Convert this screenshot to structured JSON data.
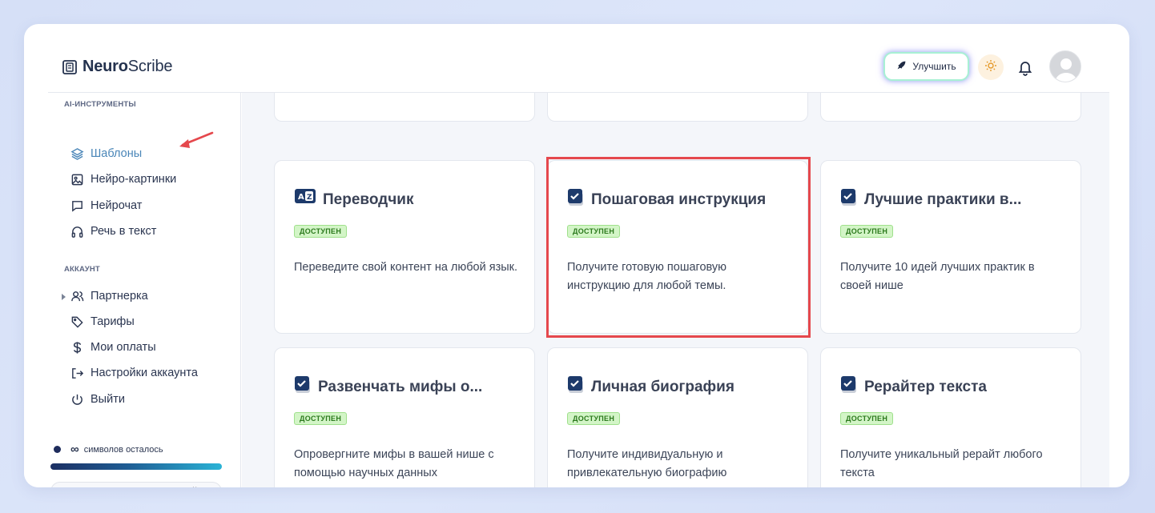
{
  "brand": {
    "name_bold": "Neuro",
    "name_light": "Scribe"
  },
  "header": {
    "upgrade_label": "Улучшить"
  },
  "sidebar": {
    "sections": {
      "ai_tools": "AI-ИНСТРУМЕНТЫ",
      "account": "АККАУНТ"
    },
    "ai_items": [
      {
        "label": "Шаблоны",
        "icon": "layers-icon",
        "active": true
      },
      {
        "label": "Нейро-картинки",
        "icon": "image-icon"
      },
      {
        "label": "Нейрочат",
        "icon": "chat-icon"
      },
      {
        "label": "Речь в текст",
        "icon": "headphones-icon"
      }
    ],
    "account_items": [
      {
        "label": "Партнерка",
        "icon": "users-icon"
      },
      {
        "label": "Тарифы",
        "icon": "tag-icon"
      },
      {
        "label": "Мои оплаты",
        "icon": "dollar-icon"
      },
      {
        "label": "Настройки аккаунта",
        "icon": "login-icon"
      },
      {
        "label": "Выйти",
        "icon": "power-icon"
      }
    ],
    "credits": {
      "symbol": "∞",
      "text": "символов осталось"
    },
    "pill_close": "×"
  },
  "cards": [
    {
      "title": "Переводчик",
      "icon": "translate-icon",
      "badge": "ДОСТУПЕН",
      "desc": "Переведите свой контент на любой язык."
    },
    {
      "title": "Пошаговая инструкция",
      "icon": "check-icon",
      "badge": "ДОСТУПЕН",
      "desc": "Получите готовую пошаговую инструкцию для любой темы.",
      "highlighted": true
    },
    {
      "title": "Лучшие практики в...",
      "icon": "check-icon",
      "badge": "ДОСТУПЕН",
      "desc": "Получите 10 идей лучших практик в своей нише"
    },
    {
      "title": "Развенчать мифы о...",
      "icon": "check-icon",
      "badge": "ДОСТУПЕН",
      "desc": "Опровергните мифы в вашей нише с помощью научных данных"
    },
    {
      "title": "Личная биография",
      "icon": "check-icon",
      "badge": "ДОСТУПЕН",
      "desc": "Получите индивидуальную и привлекательную биографию"
    },
    {
      "title": "Рерайтер текста",
      "icon": "check-icon",
      "badge": "ДОСТУПЕН",
      "desc": "Получите уникальный рерайт любого текста"
    }
  ],
  "colors": {
    "accent": "#4a86b8",
    "badge_bg": "#d3f5c7",
    "highlight": "#e5484d",
    "annotation_arrow": "#e5484d"
  }
}
